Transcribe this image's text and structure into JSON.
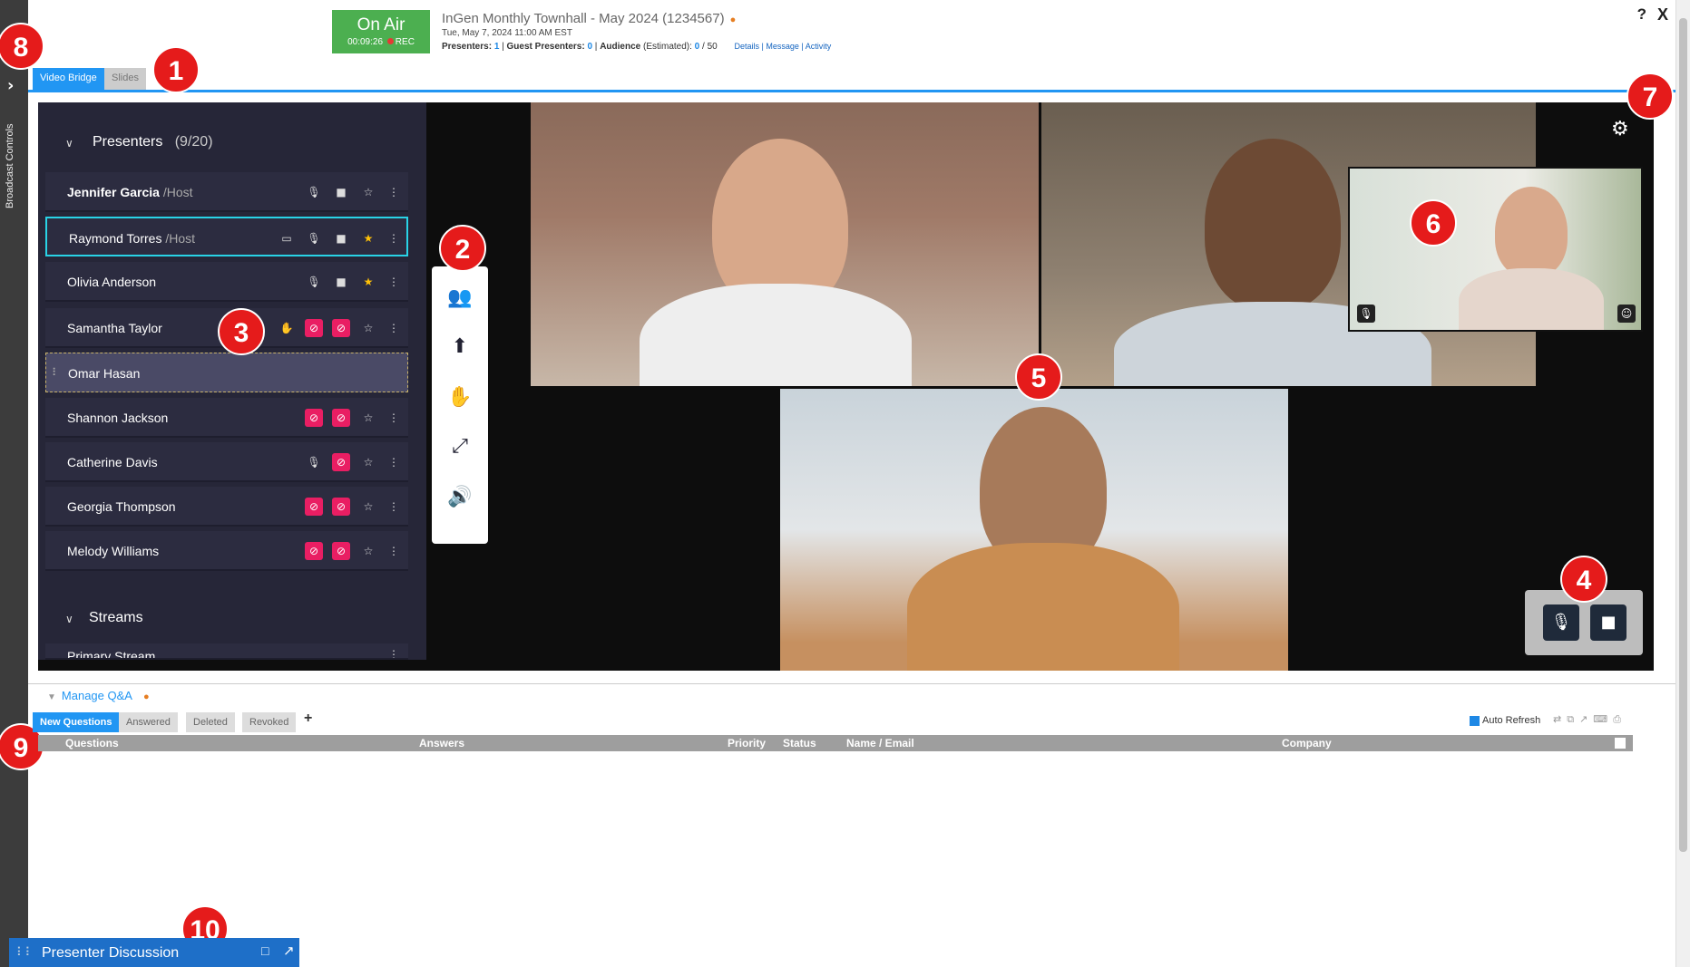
{
  "window": {
    "on_air": {
      "label": "On Air",
      "timer": "00:09:26",
      "rec": "REC"
    },
    "event_title": "InGen Monthly Townhall - May 2024 (1234567)",
    "event_date": "Tue, May 7, 2024 11:00 AM EST",
    "stats": {
      "presenters_label": "Presenters:",
      "presenters_value": "1",
      "guest_label": "Guest Presenters:",
      "guest_value": "0",
      "audience_label": "Audience",
      "audience_est": "(Estimated):",
      "audience_value": "0",
      "audience_total": "/ 50",
      "links": "Details | Message | Activity"
    },
    "help": "?",
    "close": "X"
  },
  "sidebar": {
    "label": "Broadcast Controls",
    "toggle": "›"
  },
  "tabs": [
    "Video Bridge",
    "Slides"
  ],
  "presenters_panel": {
    "title": "Presenters",
    "count": "(9/20)",
    "rows": [
      {
        "name": "Jennifer Garcia",
        "role": "/Host",
        "icons": [
          "mic",
          "cam",
          "star"
        ],
        "star_on": false
      },
      {
        "name": "Raymond Torres",
        "role": "/Host",
        "icons": [
          "screen",
          "mic",
          "cam",
          "star"
        ],
        "star_on": true
      },
      {
        "name": "Olivia Anderson",
        "role": "",
        "icons": [
          "mic",
          "cam",
          "star"
        ],
        "star_on": true
      },
      {
        "name": "Samantha Taylor",
        "role": "",
        "icons": [
          "hand",
          "mic-off",
          "cam-off",
          "star"
        ],
        "star_on": false
      },
      {
        "name": "Omar Hasan",
        "role": "",
        "icons": [],
        "star_on": false
      },
      {
        "name": "Shannon Jackson",
        "role": "",
        "icons": [
          "mic-off",
          "cam-off",
          "star"
        ],
        "star_on": false
      },
      {
        "name": "Catherine Davis",
        "role": "",
        "icons": [
          "mic",
          "cam-off",
          "star"
        ],
        "star_on": false
      },
      {
        "name": "Georgia Thompson",
        "role": "",
        "icons": [
          "mic-off",
          "cam-off",
          "star"
        ],
        "star_on": false
      },
      {
        "name": "Melody Williams",
        "role": "",
        "icons": [
          "mic-off",
          "cam-off",
          "star"
        ],
        "star_on": false
      }
    ],
    "streams_title": "Streams",
    "stream_partial": "Primary Stream"
  },
  "toolbar_icons": [
    "people-icon",
    "upload-icon",
    "hand-icon",
    "expand-icon",
    "volume-icon"
  ],
  "markers": [
    "1",
    "2",
    "3",
    "4",
    "5",
    "6",
    "7",
    "8",
    "9",
    "10"
  ],
  "qa": {
    "title": "Manage Q&A",
    "tabs": [
      "New Questions",
      "Answered",
      "Deleted",
      "Revoked"
    ],
    "add": "+",
    "auto_refresh": "Auto Refresh",
    "columns": [
      "Questions",
      "Answers",
      "Priority",
      "Status",
      "Name / Email",
      "Company"
    ]
  },
  "discussion": {
    "title": "Presenter Discussion"
  }
}
